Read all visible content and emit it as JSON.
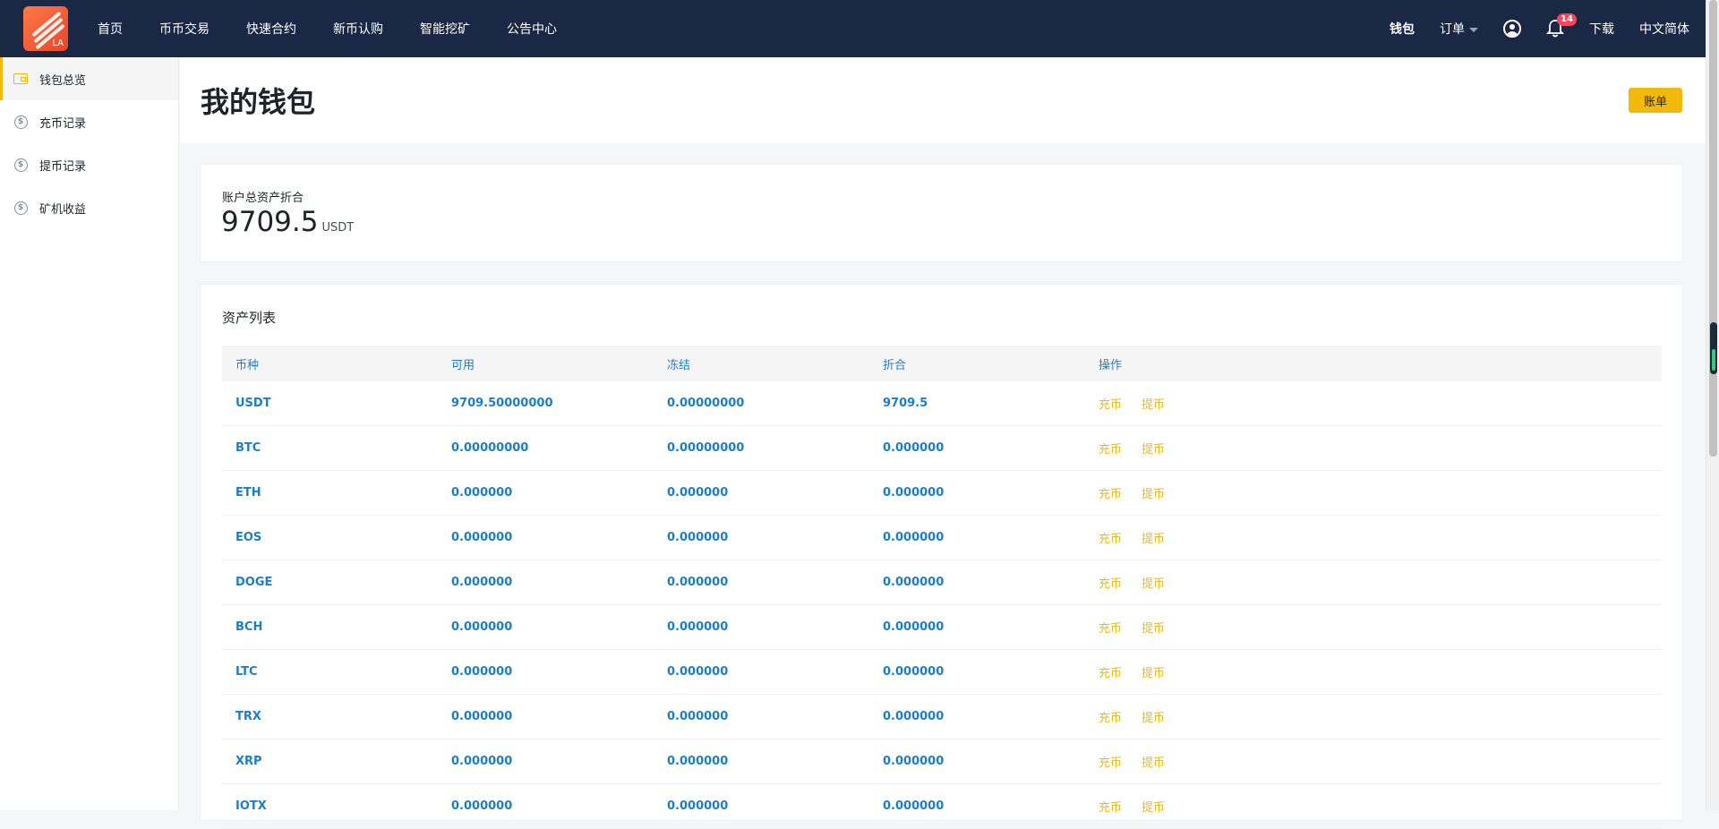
{
  "nav": {
    "logo_text": "LA",
    "items": [
      "首页",
      "币币交易",
      "快速合约",
      "新币认购",
      "智能挖矿",
      "公告中心"
    ],
    "right": {
      "wallet": "钱包",
      "orders": "订单",
      "notifications_count": "14",
      "download": "下载",
      "language": "中文简体"
    }
  },
  "sidebar": {
    "items": [
      {
        "label": "钱包总览",
        "icon": "wallet-icon"
      },
      {
        "label": "充币记录",
        "icon": "dollar-icon"
      },
      {
        "label": "提币记录",
        "icon": "dollar-icon"
      },
      {
        "label": "矿机收益",
        "icon": "dollar-icon"
      }
    ]
  },
  "header": {
    "title": "我的钱包",
    "bill_button": "账单"
  },
  "summary": {
    "label": "账户总资产折合",
    "value": "9709.5",
    "unit": "USDT"
  },
  "assets": {
    "title": "资产列表",
    "columns": [
      "币种",
      "可用",
      "冻结",
      "折合",
      "操作"
    ],
    "deposit_label": "充币",
    "withdraw_label": "提币",
    "rows": [
      {
        "coin": "USDT",
        "available": "9709.50000000",
        "frozen": "0.00000000",
        "value": "9709.5"
      },
      {
        "coin": "BTC",
        "available": "0.00000000",
        "frozen": "0.00000000",
        "value": "0.000000"
      },
      {
        "coin": "ETH",
        "available": "0.000000",
        "frozen": "0.000000",
        "value": "0.000000"
      },
      {
        "coin": "EOS",
        "available": "0.000000",
        "frozen": "0.000000",
        "value": "0.000000"
      },
      {
        "coin": "DOGE",
        "available": "0.000000",
        "frozen": "0.000000",
        "value": "0.000000"
      },
      {
        "coin": "BCH",
        "available": "0.000000",
        "frozen": "0.000000",
        "value": "0.000000"
      },
      {
        "coin": "LTC",
        "available": "0.000000",
        "frozen": "0.000000",
        "value": "0.000000"
      },
      {
        "coin": "TRX",
        "available": "0.000000",
        "frozen": "0.000000",
        "value": "0.000000"
      },
      {
        "coin": "XRP",
        "available": "0.000000",
        "frozen": "0.000000",
        "value": "0.000000"
      },
      {
        "coin": "IOTX",
        "available": "0.000000",
        "frozen": "0.000000",
        "value": "0.000000"
      }
    ]
  },
  "colors": {
    "nav_bg": "#1b2845",
    "accent": "#f0b90b",
    "link_blue": "#1d7ec8",
    "badge": "#f6465d"
  }
}
